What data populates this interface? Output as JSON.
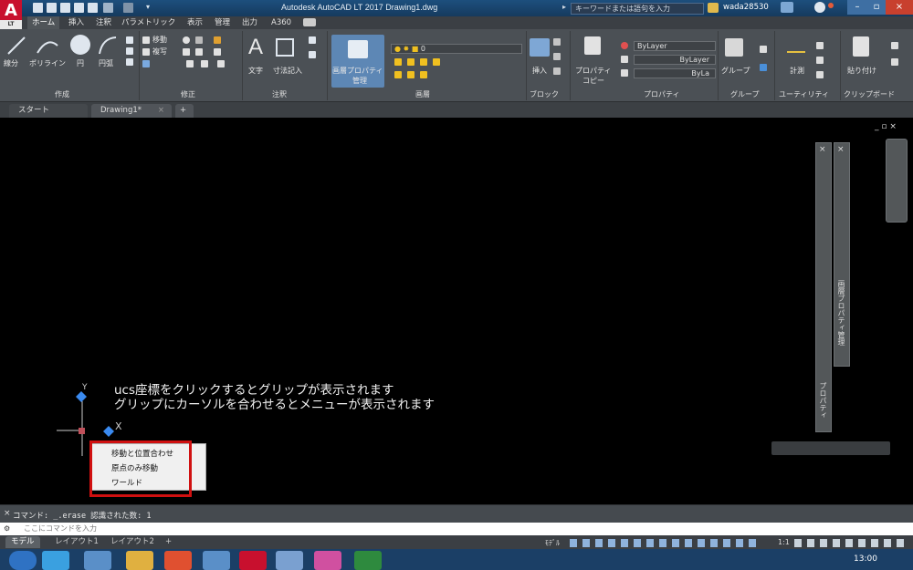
{
  "titlebar": {
    "title": "Autodesk AutoCAD LT 2017    Drawing1.dwg",
    "search_placeholder": "キーワードまたは語句を入力",
    "user": "wada28530",
    "app_logo": "A",
    "app_logo_sub": "LT"
  },
  "ribbon_tabs": [
    "ホーム",
    "挿入",
    "注釈",
    "パラメトリック",
    "表示",
    "管理",
    "出力",
    "A360"
  ],
  "ribbon": {
    "draw": {
      "line": "線分",
      "polyline": "ポリライン",
      "circle": "円",
      "arc": "円弧",
      "title": "作成"
    },
    "modify": {
      "move": "移動",
      "copy": "複写",
      "title": "修正"
    },
    "annotation": {
      "text": "文字",
      "dimension": "寸法記入",
      "title": "注釈"
    },
    "layers": {
      "props": "画層プロパティ",
      "props2": "管理",
      "current": "0",
      "title": "画層"
    },
    "block": {
      "insert": "挿入",
      "title": "ブロック"
    },
    "properties": {
      "match": "プロパティ",
      "match2": "コピー",
      "bylayer1": "ByLayer",
      "bylayer2": "ByLayer",
      "bylayer3": "ByLa",
      "title": "プロパティ"
    },
    "groups": {
      "group": "グループ",
      "title": "グループ"
    },
    "utilities": {
      "measure": "計測",
      "title": "ユーティリティ"
    },
    "clipboard": {
      "paste": "貼り付け",
      "title": "クリップボード"
    }
  },
  "doc_tabs": {
    "start": "スタート",
    "drawing": "Drawing1*",
    "add": "+"
  },
  "canvas": {
    "annotation_line1": "ucs座標をクリックするとグリップが表示されます",
    "annotation_line2": "グリップにカーソルを合わせるとメニューが表示されます",
    "ucs_y": "Y",
    "ucs_x": "X",
    "palette_label1": "画層プロパティ管理",
    "palette_label2": "プロパティ",
    "window_controls": "_ ▫ ×"
  },
  "context_menu": {
    "items": [
      "移動と位置合わせ",
      "原点のみ移動",
      "ワールド"
    ]
  },
  "command": {
    "history": "コマンド: _.erase 認識された数: 1",
    "prompt": "ここにコマンドを入力"
  },
  "layout_tabs": [
    "モデル",
    "レイアウト1",
    "レイアウト2",
    "+"
  ],
  "status": {
    "model": "ﾓﾃﾞﾙ",
    "scale": "1:1"
  },
  "taskbar": {
    "time": "13:00"
  },
  "colors": {
    "accent": "#c8102e",
    "ribbon_bg": "#4b5055",
    "highlight": "#d01010"
  }
}
